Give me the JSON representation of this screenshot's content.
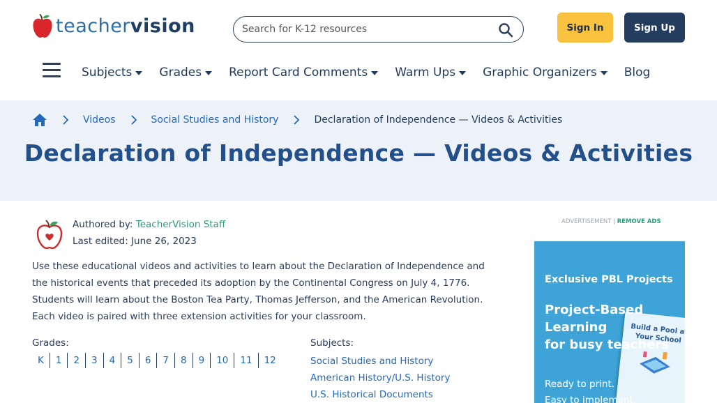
{
  "header": {
    "logo_part1": "teacher",
    "logo_part2": "vision",
    "search_placeholder": "Search for K-12 resources",
    "signin_label": "Sign In",
    "signup_label": "Sign Up"
  },
  "nav": {
    "items": [
      {
        "label": "Subjects"
      },
      {
        "label": "Grades"
      },
      {
        "label": "Report Card Comments"
      },
      {
        "label": "Warm Ups"
      },
      {
        "label": "Graphic Organizers"
      },
      {
        "label": "Blog"
      }
    ]
  },
  "breadcrumb": {
    "items": [
      "Videos",
      "Social Studies and History"
    ],
    "current": "Declaration of Independence — Videos & Activities"
  },
  "page": {
    "title": "Declaration of Independence — Videos & Activities",
    "authored_prefix": "Authored by:",
    "author": "TeacherVision Staff",
    "edited": "Last edited: June 26, 2023",
    "intro": "Use these educational videos and activities to learn about the Declaration of Independence and the historical events that preceded its adoption by the Continental Congress on July 4, 1776. Students will learn about the Boston Tea Party, Thomas Jefferson, and the American Revolution. Each video is paired with three extension activities for your classroom.",
    "grades_label": "Grades:",
    "grades": [
      "K",
      "1",
      "2",
      "3",
      "4",
      "5",
      "6",
      "7",
      "8",
      "9",
      "10",
      "11",
      "12"
    ],
    "subjects_label": "Subjects:",
    "subjects": [
      "Social Studies and History",
      "American History/U.S. History",
      "U.S. Historical Documents"
    ]
  },
  "ad": {
    "label": "ADVERTISEMENT |",
    "remove": "REMOVE ADS",
    "eyebrow": "Exclusive PBL Projects",
    "headline_line1": "Project-Based",
    "headline_line2": "Learning",
    "headline_line3": "for busy teachers",
    "book_title": "Build a Pool at Your School",
    "copy_line1": "Ready to print.",
    "copy_line2": "Easy to implement."
  },
  "colors": {
    "brand_navy": "#243d5e",
    "accent_yellow": "#f9c23e",
    "link_blue": "#2369b8",
    "link_green": "#2d9a7a",
    "band_bg": "#edf2f8",
    "ad_bg": "#3ea4d8"
  }
}
